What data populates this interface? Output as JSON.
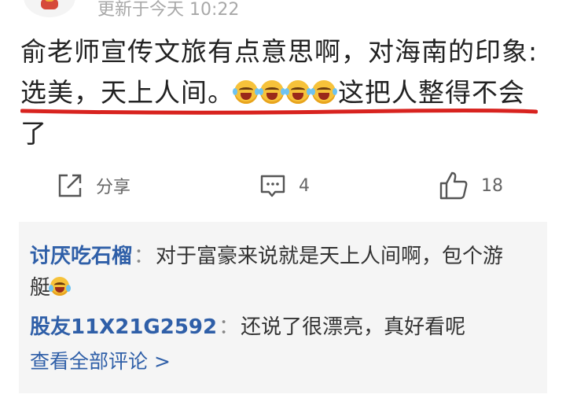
{
  "header": {
    "timestamp": "更新于今天 10:22"
  },
  "comment": {
    "line1": "俞老师宣传文旅有点意思啊，对海南的印象:",
    "line2_before": "选美，天上人间。",
    "line2_after": "这把人整得不会",
    "line3": "了",
    "emoji_name": "laughing-tears-emoji",
    "underline_color": "#d8231f"
  },
  "actions": {
    "share_label": "分享",
    "comment_count": "4",
    "like_count": "18"
  },
  "replies": [
    {
      "user": "讨厌吃石榴",
      "separator": "：",
      "text_line1": "对于富豪来说就是天上人间啊，包个游",
      "text_line2": "艇"
    },
    {
      "user": "股友11X21G2592",
      "separator": "：",
      "text_line1": "还说了很漂亮，真好看呢"
    }
  ],
  "view_all": "查看全部评论 >",
  "colors": {
    "link": "#2f5fa8",
    "muted": "#a8a8a8",
    "reply_bg": "#f5f5f5"
  }
}
